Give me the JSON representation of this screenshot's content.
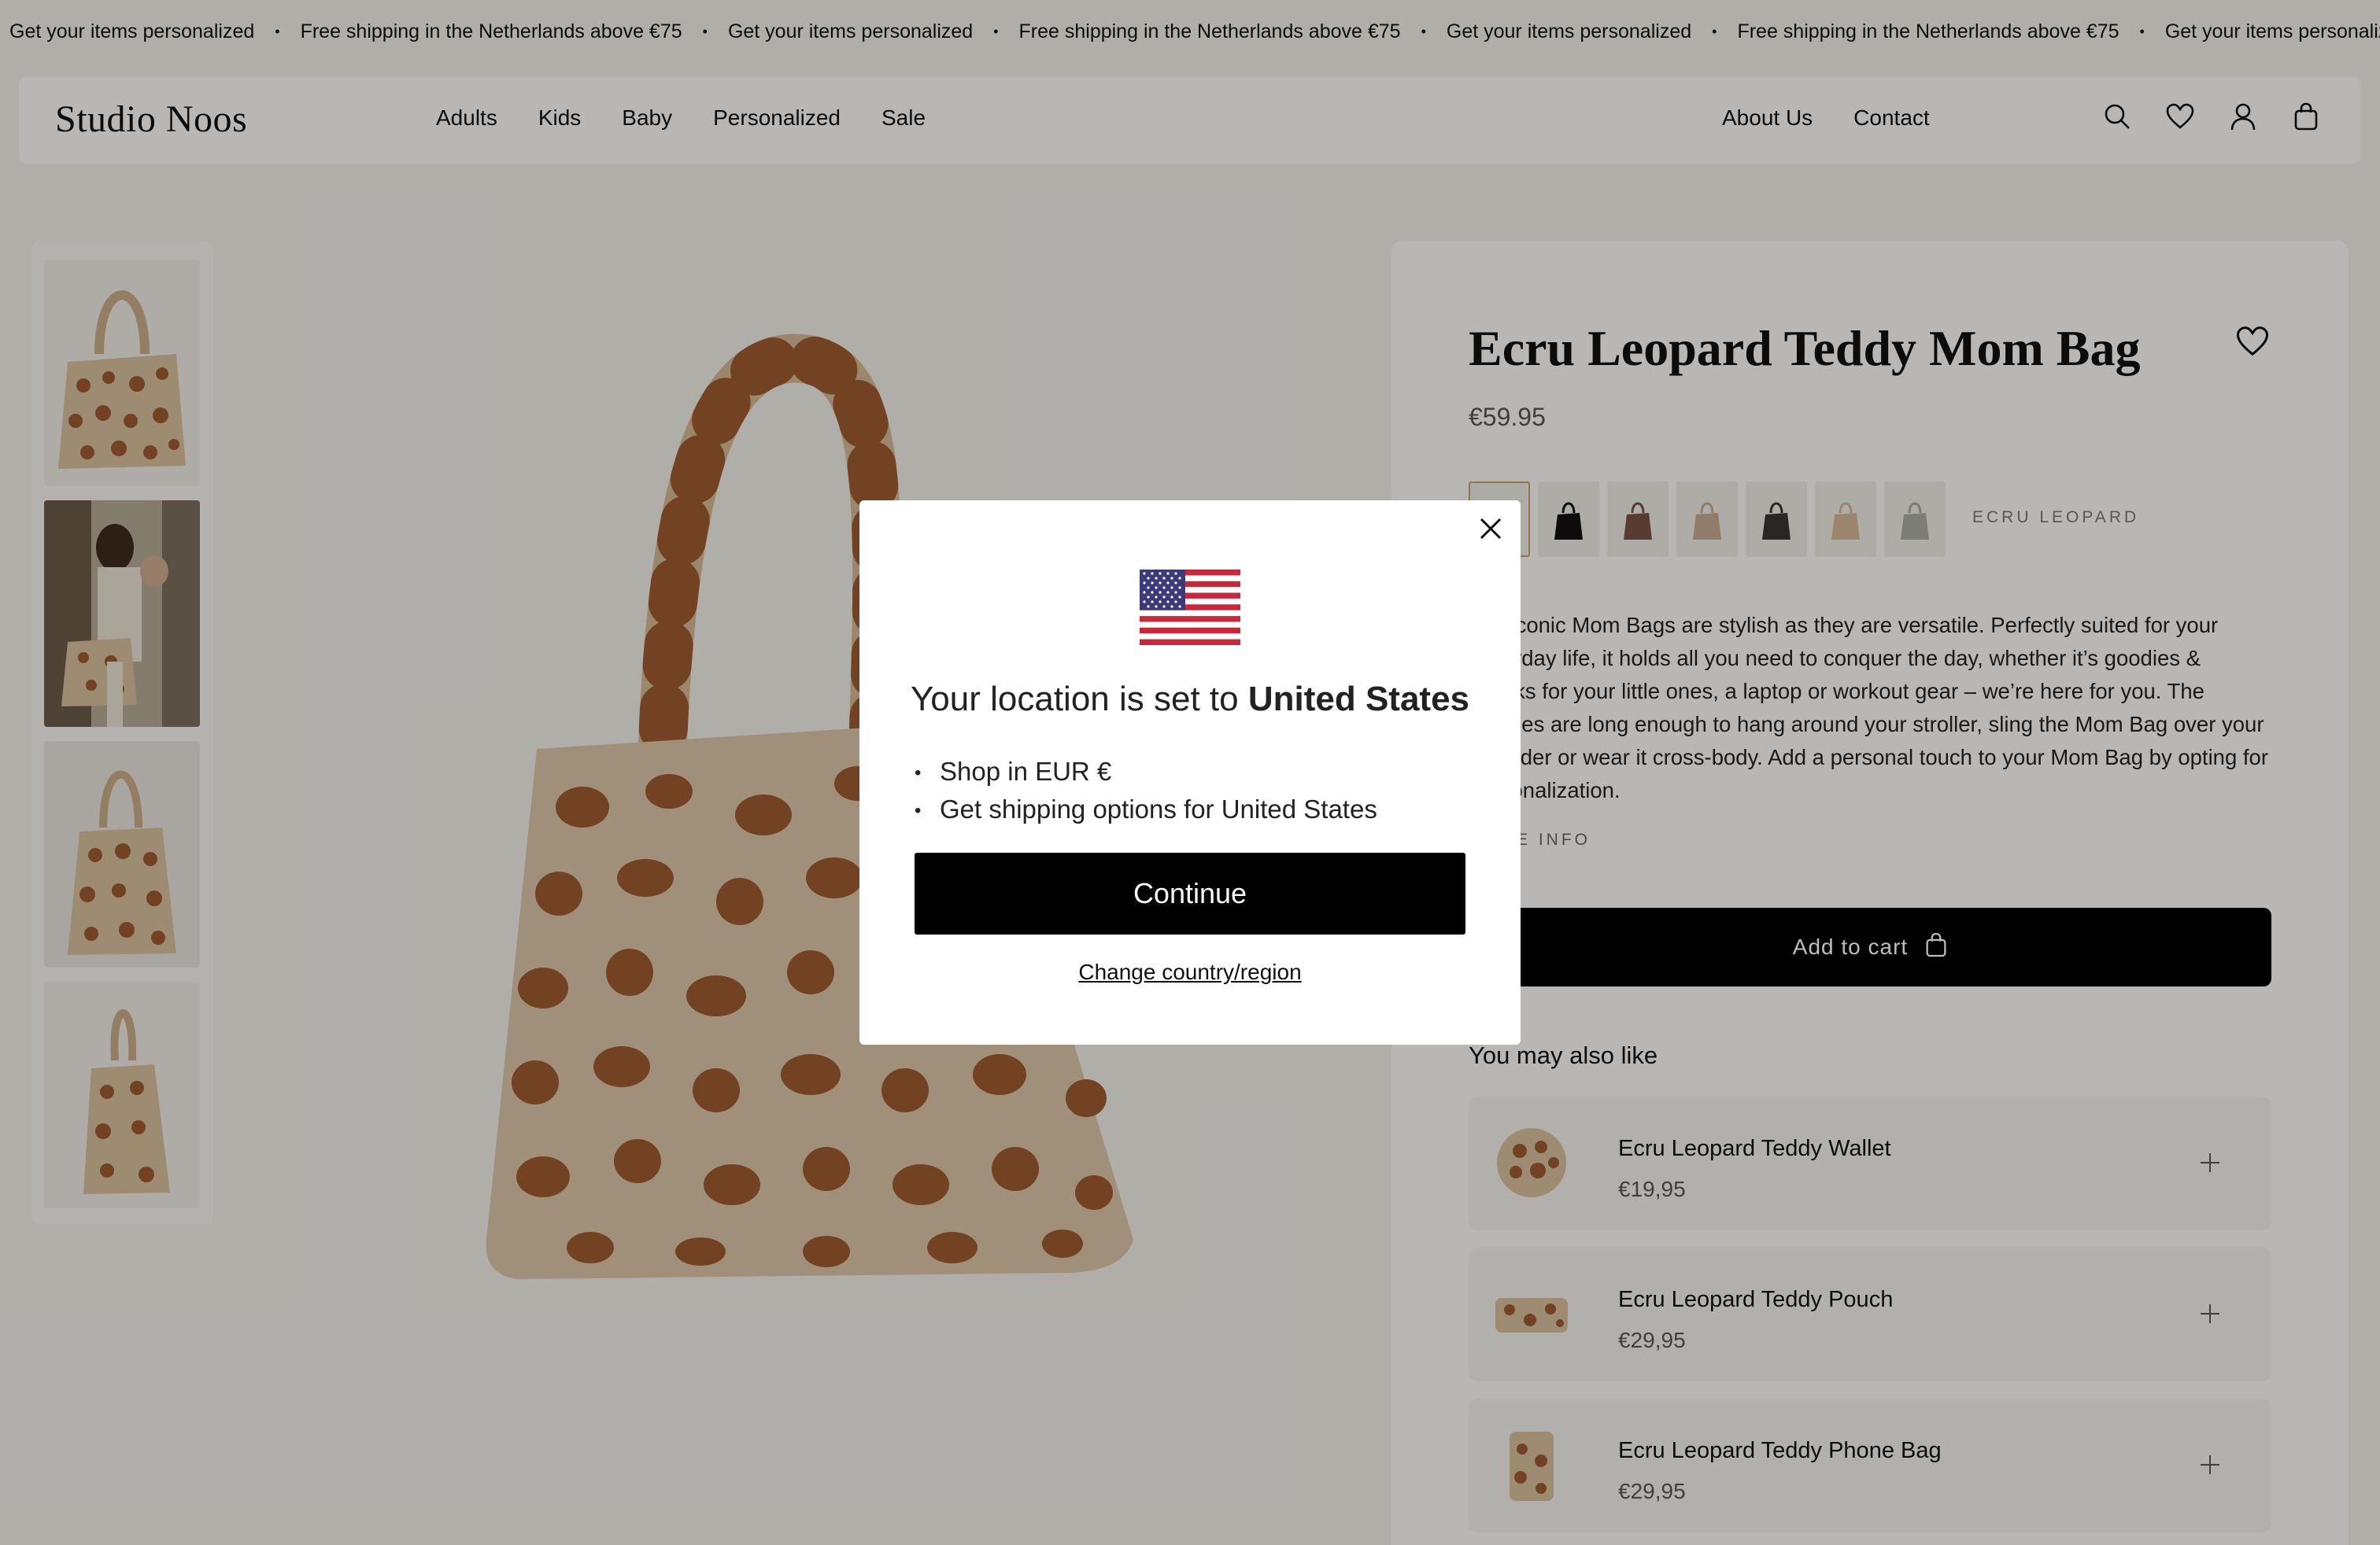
{
  "announcement": {
    "messages": [
      "Get your items personalized",
      "Free shipping in the Netherlands above €75",
      "Get your items personalized",
      "Free shipping in the Netherlands above €75",
      "Get your items personalized",
      "Free shipping in the Netherlands above €75",
      "Get your items personalized"
    ],
    "separator": "•"
  },
  "header": {
    "logo": "Studio Noos",
    "nav_left": [
      "Adults",
      "Kids",
      "Baby",
      "Personalized",
      "Sale"
    ],
    "nav_right": [
      "About Us",
      "Contact"
    ],
    "icons": [
      "search-icon",
      "heart-icon",
      "account-icon",
      "bag-icon"
    ]
  },
  "product": {
    "title": "Ecru Leopard Teddy Mom Bag",
    "price": "€59.95",
    "selected_color": "ECRU LEOPARD",
    "swatch_colors": [
      "#c9a07a",
      "#111111",
      "#7a5040",
      "#c4a88e",
      "#3a3430",
      "#d2b591",
      "#a9ab9c"
    ],
    "description": "Our iconic Mom Bags are stylish as they are versatile. Perfectly suited for your everyday life, it holds all you need to conquer the day, whether it’s goodies & snacks for your little ones, a laptop or workout gear – we’re here for you. The handles are long enough to hang around your stroller, sling the Mom Bag over your shoulder or wear it cross-body. Add a personal touch to your Mom Bag by opting for personalization.",
    "more_info": "MORE INFO",
    "add_to_cart": "Add to cart"
  },
  "recommendations": {
    "heading": "You may also like",
    "items": [
      {
        "name": "Ecru Leopard Teddy Wallet",
        "price": "€19,95"
      },
      {
        "name": "Ecru Leopard Teddy Pouch",
        "price": "€29,95"
      },
      {
        "name": "Ecru Leopard Teddy Phone Bag",
        "price": "€29,95"
      }
    ]
  },
  "modal": {
    "heading_prefix": "Your location is set to",
    "country": "United States",
    "bullets": [
      "Shop in EUR €",
      "Get shipping options for United States"
    ],
    "continue": "Continue",
    "change": "Change country/region"
  },
  "colors": {
    "accent": "#000000",
    "background": "#eeebe5",
    "leopard_base": "#d8c3a5",
    "leopard_spot": "#9a5a2e"
  }
}
